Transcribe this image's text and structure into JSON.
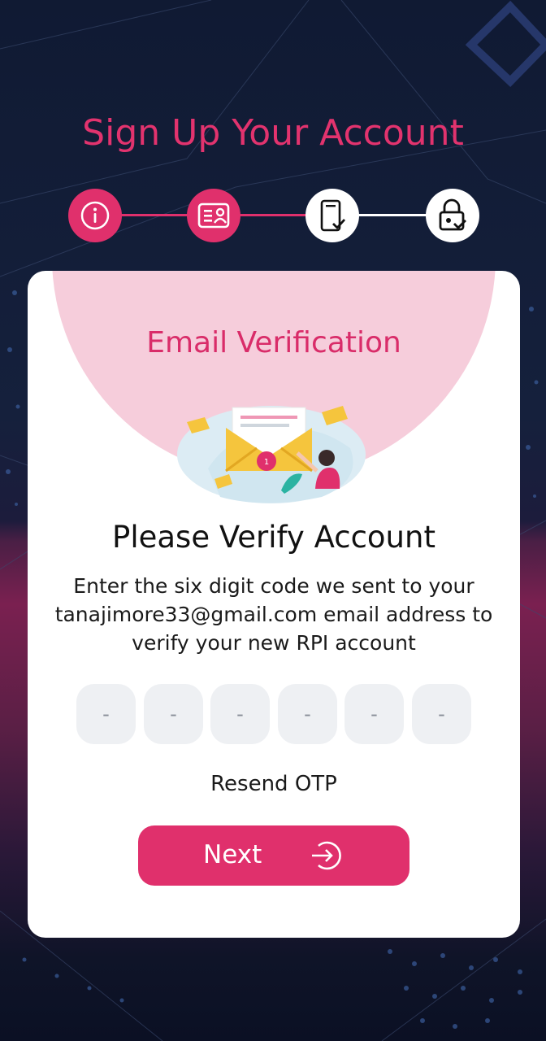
{
  "header": {
    "title": "Sign Up Your Account"
  },
  "stepper": {
    "steps": [
      {
        "icon": "info-icon",
        "state": "active"
      },
      {
        "icon": "id-card-icon",
        "state": "active"
      },
      {
        "icon": "phone-check-icon",
        "state": "inactive"
      },
      {
        "icon": "lock-check-icon",
        "state": "inactive"
      }
    ],
    "colors": {
      "active": "#e0306c",
      "inactive": "#ffffff"
    }
  },
  "card": {
    "heading": "Email Verification",
    "illustration": "email-verification-illustration",
    "verify_title": "Please Verify Account",
    "verify_text": "Enter the six digit code we sent to your tanajimore33@gmail.com email address to verify your new RPI account",
    "otp": {
      "placeholders": [
        "-",
        "-",
        "-",
        "-",
        "-",
        "-"
      ],
      "values": [
        "",
        "",
        "",
        "",
        "",
        ""
      ]
    },
    "resend_label": "Resend OTP",
    "next_label": "Next"
  },
  "colors": {
    "accent": "#e0306c",
    "pink_soft": "#f6cddb",
    "background_dark": "#101a33"
  }
}
